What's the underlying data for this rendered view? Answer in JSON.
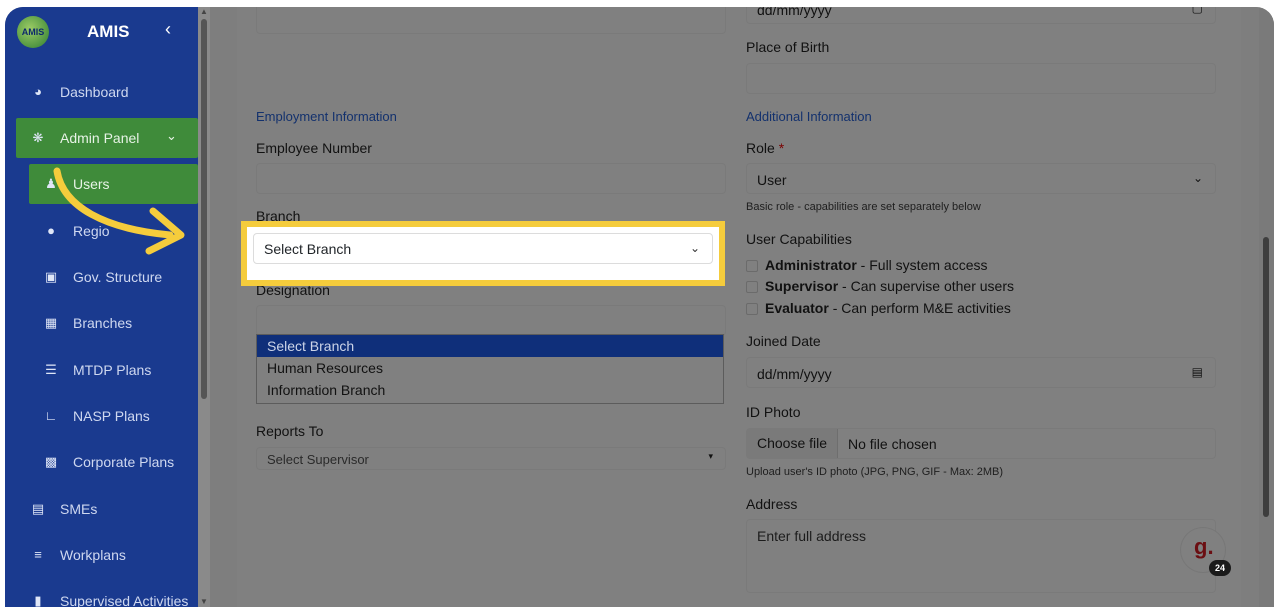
{
  "sidebar": {
    "brand": "AMIS",
    "logo_text": "AMIS",
    "items": [
      {
        "label": "Dashboard",
        "icon": "dashboard-icon"
      },
      {
        "label": "Admin Panel",
        "icon": "gear-icon"
      },
      {
        "label": "Users",
        "icon": "users-icon"
      },
      {
        "label": "Regio",
        "icon": "map-pin-icon"
      },
      {
        "label": "Gov. Structure",
        "icon": "sitemap-icon"
      },
      {
        "label": "Branches",
        "icon": "building-icon"
      },
      {
        "label": "MTDP Plans",
        "icon": "network-icon"
      },
      {
        "label": "NASP Plans",
        "icon": "chart-line-icon"
      },
      {
        "label": "Corporate Plans",
        "icon": "briefcase-icon"
      },
      {
        "label": "SMEs",
        "icon": "store-icon"
      },
      {
        "label": "Workplans",
        "icon": "list-icon"
      },
      {
        "label": "Supervised Activities",
        "icon": "clipboard-icon"
      }
    ]
  },
  "form": {
    "top_date_placeholder": "dd/mm/yyyy",
    "place_of_birth_label": "Place of Birth",
    "employment_heading": "Employment Information",
    "additional_heading": "Additional Information",
    "employee_number_label": "Employee Number",
    "branch_label": "Branch",
    "branch_value": "Select Branch",
    "designation_label": "Designation",
    "branch_options": [
      "Select Branch",
      "Human Resources",
      "Information Branch"
    ],
    "reports_to_label": "Reports To",
    "reports_to_value": "Select Supervisor",
    "role_label": "Role",
    "role_required": "*",
    "role_value": "User",
    "role_hint": "Basic role - capabilities are set separately below",
    "capabilities_label": "User Capabilities",
    "capabilities": [
      {
        "name": "Administrator",
        "desc": " - Full system access"
      },
      {
        "name": "Supervisor",
        "desc": " - Can supervise other users"
      },
      {
        "name": "Evaluator",
        "desc": " - Can perform M&E activities"
      }
    ],
    "joined_date_label": "Joined Date",
    "joined_date_placeholder": "dd/mm/yyyy",
    "id_photo_label": "ID Photo",
    "choose_file": "Choose file",
    "no_file": "No file chosen",
    "id_photo_hint": "Upload user's ID photo (JPG, PNG, GIF - Max: 2MB)",
    "address_label": "Address",
    "address_placeholder": "Enter full address"
  },
  "help": {
    "glyph": "g.",
    "count": "24"
  },
  "colors": {
    "highlight": "#f5cc3c",
    "sidebar": "#1a3a8f",
    "active": "#3f8b3a"
  }
}
